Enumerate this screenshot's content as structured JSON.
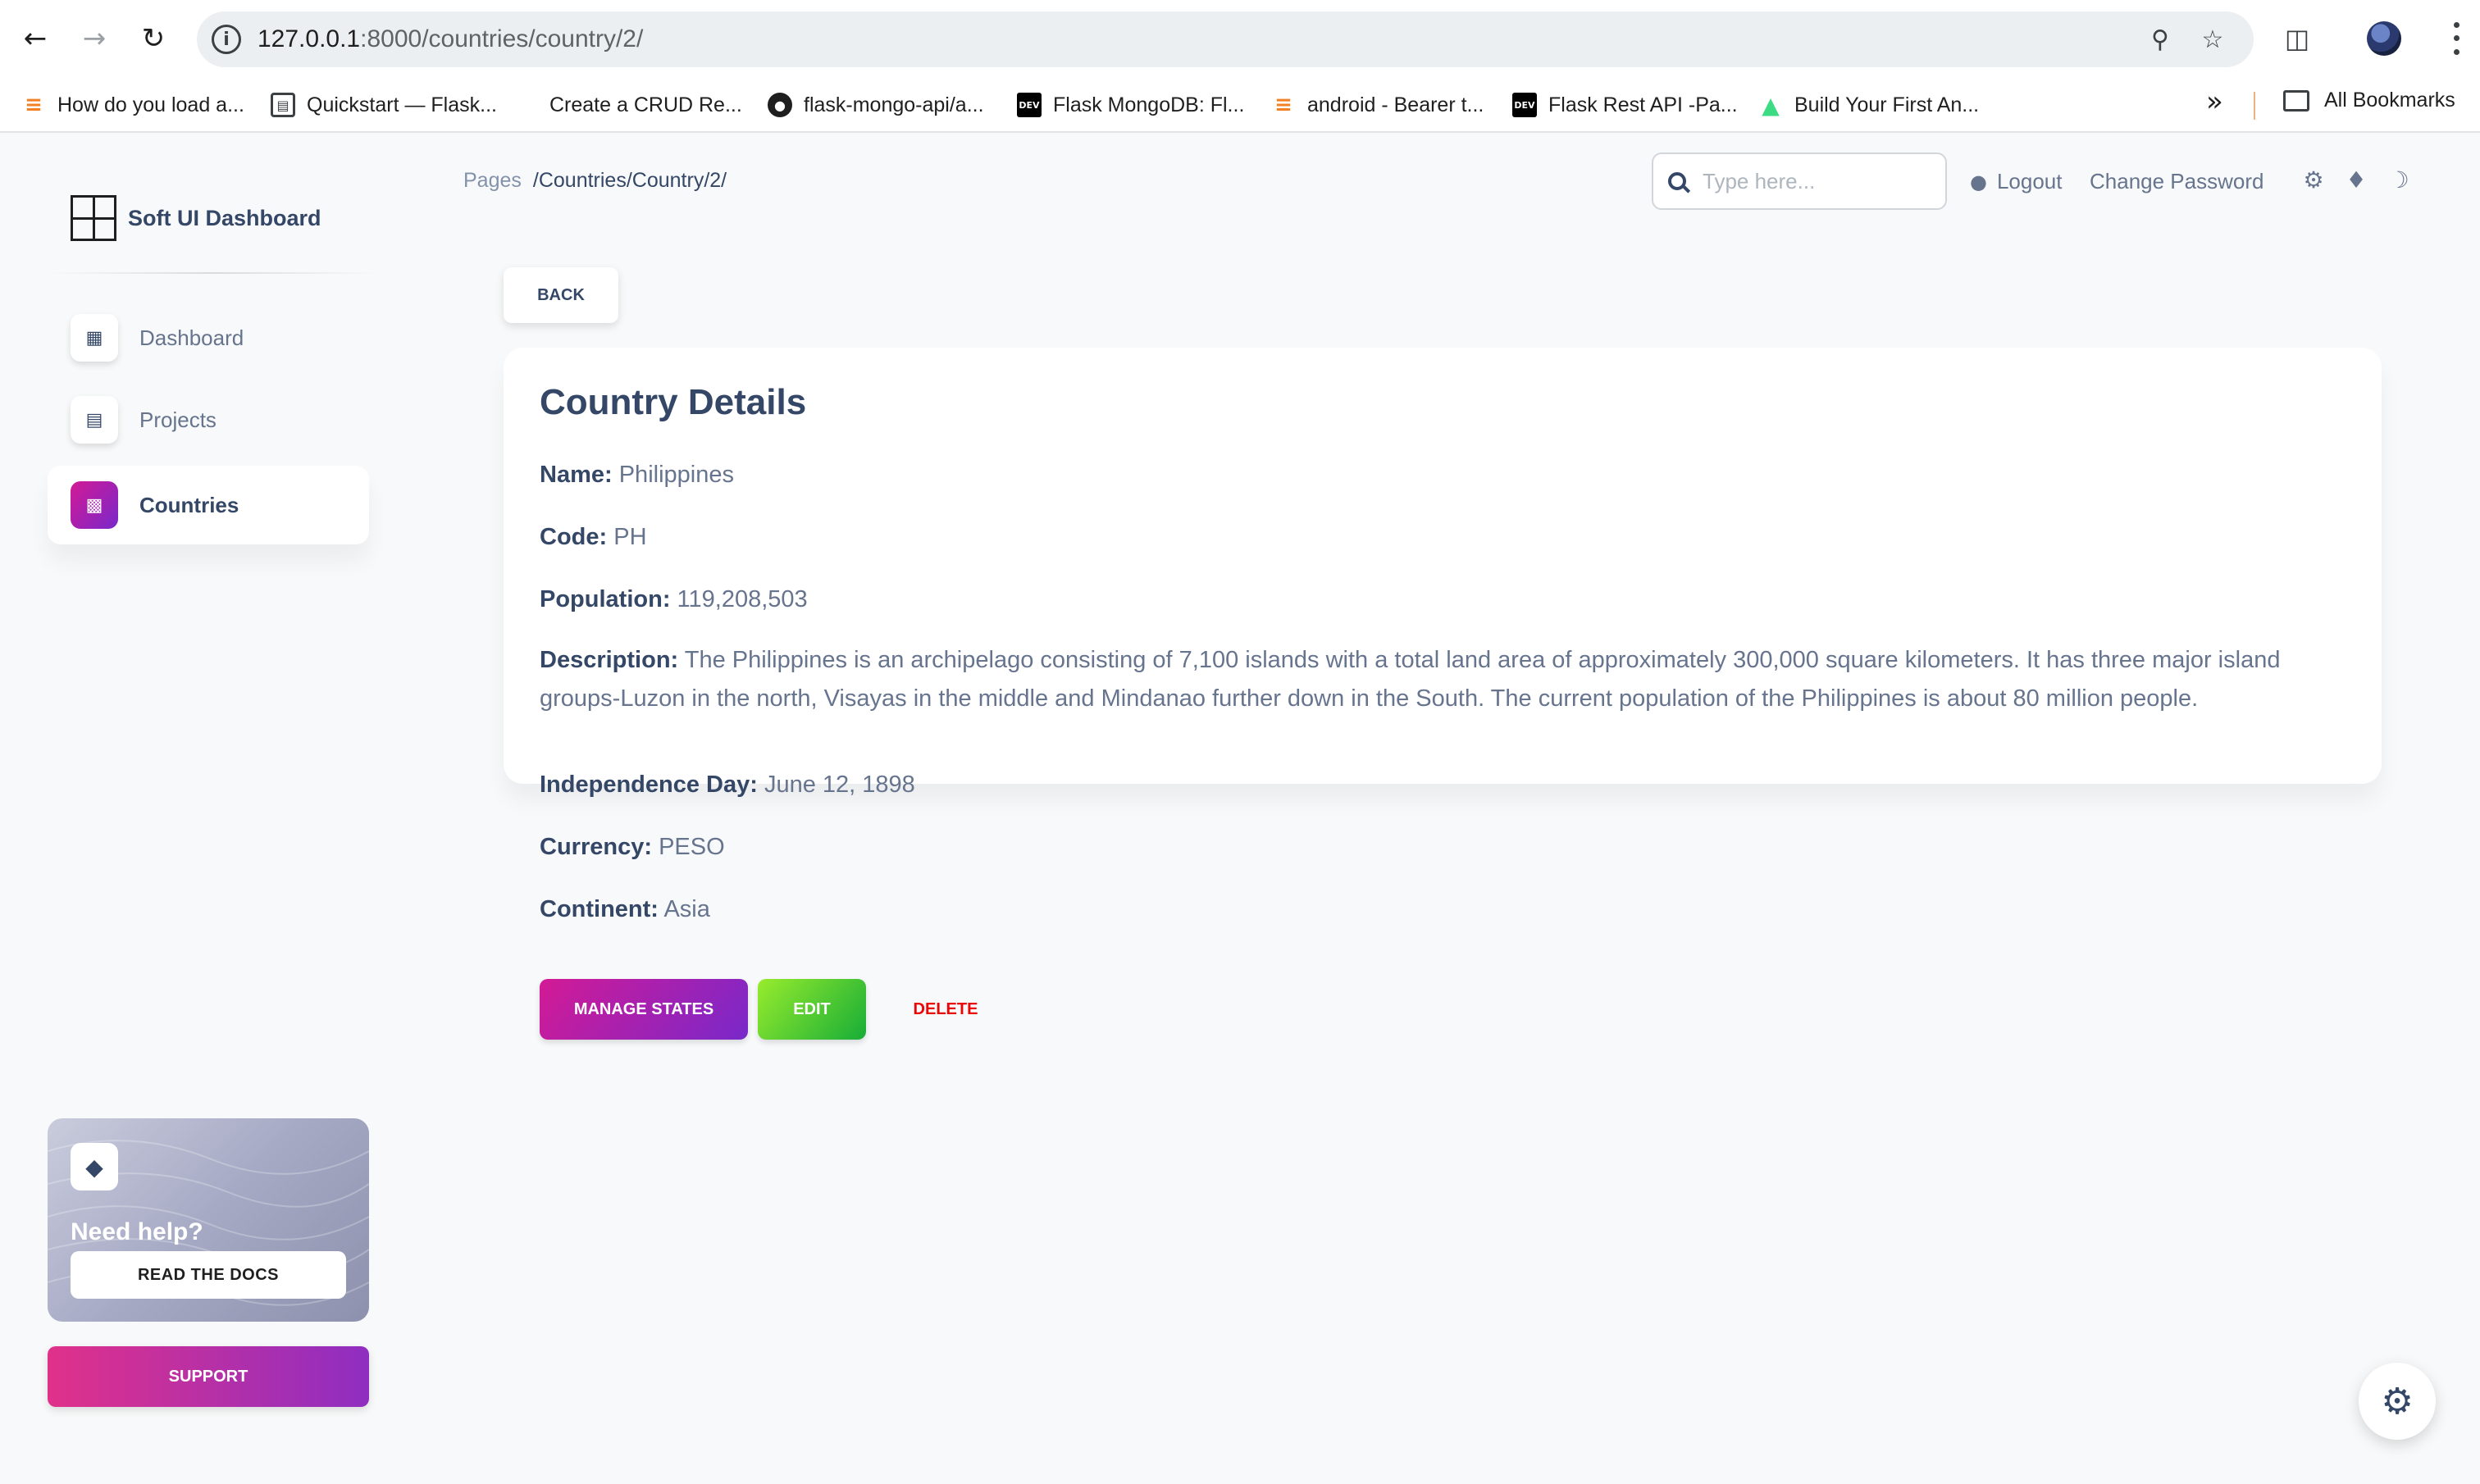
{
  "browser": {
    "url_host": "127.0.0.1",
    "url_path": ":8000/countries/country/2/",
    "bookmarks": [
      {
        "label": "How do you load a...",
        "icon": "stackoverflow-icon"
      },
      {
        "label": "Quickstart — Flask...",
        "icon": "docs-icon"
      },
      {
        "label": "Create a CRUD Re...",
        "icon": "blank-icon"
      },
      {
        "label": "flask-mongo-api/a...",
        "icon": "github-icon"
      },
      {
        "label": "Flask MongoDB: Fl...",
        "icon": "dev-icon"
      },
      {
        "label": "android - Bearer t...",
        "icon": "stackoverflow-icon"
      },
      {
        "label": "Flask Rest API -Pa...",
        "icon": "dev-icon"
      },
      {
        "label": "Build Your First An...",
        "icon": "android-icon"
      }
    ],
    "all_bookmarks": "All Bookmarks"
  },
  "sidebar": {
    "brand": "Soft UI Dashboard",
    "items": [
      {
        "label": "Dashboard",
        "icon": "shop-icon",
        "active": false
      },
      {
        "label": "Projects",
        "icon": "document-icon",
        "active": false
      },
      {
        "label": "Countries",
        "icon": "building-icon",
        "active": true
      }
    ],
    "help": {
      "title": "Need help?",
      "button": "READ THE DOCS"
    },
    "support": "SUPPORT"
  },
  "topbar": {
    "breadcrumb_root": "Pages",
    "breadcrumb_current": "/Countries/Country/2/",
    "search_placeholder": "Type here...",
    "logout": "Logout",
    "change_password": "Change Password"
  },
  "main": {
    "back": "BACK",
    "card_title": "Country Details",
    "fields": [
      {
        "label": "Name:",
        "value": "Philippines"
      },
      {
        "label": "Code:",
        "value": "PH"
      },
      {
        "label": "Population:",
        "value": "119,208,503"
      },
      {
        "label": "Description:",
        "value": "The Philippines is an archipelago consisting of 7,100 islands with a total land area of approximately 300,000 square kilometers. It has three major island groups-Luzon in the north, Visayas in the middle and Mindanao further down in the South. The current population of the Philippines is about 80 million people."
      },
      {
        "label": "Independence Day:",
        "value": "June 12, 1898"
      },
      {
        "label": "Currency:",
        "value": "PESO"
      },
      {
        "label": "Continent:",
        "value": "Asia"
      }
    ],
    "actions": {
      "manage_states": "MANAGE STATES",
      "edit": "EDIT",
      "delete": "DELETE"
    }
  },
  "colors": {
    "primary_gradient_start": "#7928ca",
    "primary_gradient_end": "#d31a95",
    "success_gradient_start": "#17ad37",
    "success_gradient_end": "#98ec2d",
    "danger": "#ea0606",
    "text_dark": "#344767",
    "text_muted": "#67748e"
  }
}
